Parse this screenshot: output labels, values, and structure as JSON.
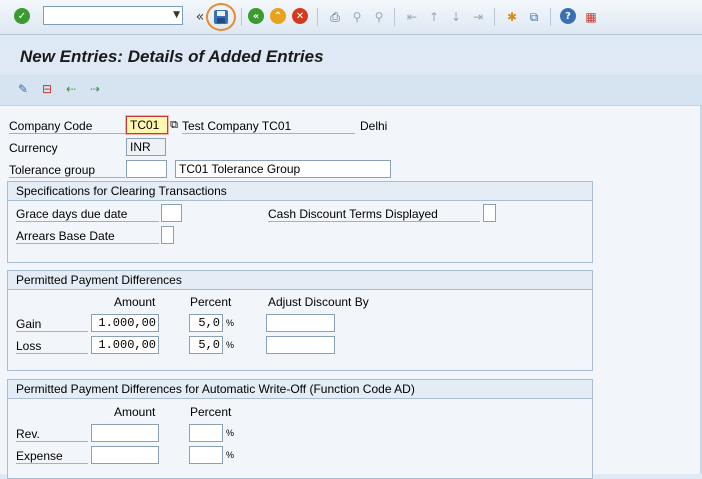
{
  "title": "New Entries: Details of Added Entries",
  "toolbar": {
    "command_value": "",
    "icons": [
      "enter-icon",
      "back-icon",
      "exit-icon",
      "cancel-icon",
      "print-icon",
      "find-icon",
      "find-next-icon",
      "first-page-icon",
      "prev-page-icon",
      "next-page-icon",
      "last-page-icon",
      "new-session-icon",
      "shortcut-icon",
      "help-icon",
      "customize-layout-icon"
    ]
  },
  "fields": {
    "company_code_label": "Company Code",
    "company_code_value": "TC01",
    "company_name": "Test Company TC01",
    "city": "Delhi",
    "currency_label": "Currency",
    "currency_value": "INR",
    "tolerance_group_label": "Tolerance group",
    "tolerance_group_value": "",
    "tolerance_group_desc": "TC01 Tolerance Group"
  },
  "clearing": {
    "header": "Specifications for Clearing Transactions",
    "grace_days_label": "Grace days due date",
    "grace_days_value": "",
    "cash_discount_label": "Cash Discount Terms Displayed",
    "arrears_label": "Arrears Base Date"
  },
  "payment_diff": {
    "header": "Permitted Payment Differences",
    "col_amount": "Amount",
    "col_percent": "Percent",
    "col_adjust": "Adjust Discount By",
    "pct_sign": "%",
    "rows": [
      {
        "label": "Gain",
        "amount": "1.000,00",
        "percent": "5,0",
        "adjust": ""
      },
      {
        "label": "Loss",
        "amount": "1.000,00",
        "percent": "5,0",
        "adjust": ""
      }
    ]
  },
  "writeoff": {
    "header": "Permitted Payment Differences for Automatic Write-Off (Function Code AD)",
    "col_amount": "Amount",
    "col_percent": "Percent",
    "pct_sign": "%",
    "rows": [
      {
        "label": "Rev.",
        "amount": "",
        "percent": ""
      },
      {
        "label": "Expense",
        "amount": "",
        "percent": ""
      }
    ]
  },
  "colors": {
    "accent": "#e88a2e",
    "focus_border": "#c93636",
    "focus_bg": "#fff6b0"
  }
}
